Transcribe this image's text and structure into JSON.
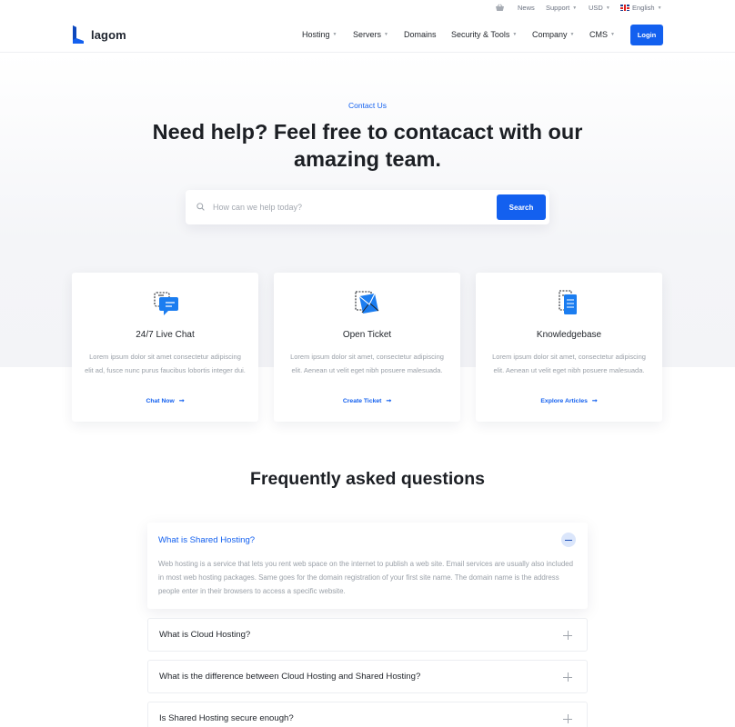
{
  "topbar": {
    "cart_icon": "basket-icon",
    "news": "News",
    "support": "Support",
    "currency": "USD",
    "language": "English",
    "flag_icon": "uk-flag-icon"
  },
  "header": {
    "brand": "lagom",
    "nav": [
      {
        "label": "Hosting",
        "dropdown": true
      },
      {
        "label": "Servers",
        "dropdown": true
      },
      {
        "label": "Domains",
        "dropdown": false
      },
      {
        "label": "Security & Tools",
        "dropdown": true
      },
      {
        "label": "Company",
        "dropdown": true
      },
      {
        "label": "CMS",
        "dropdown": true
      }
    ],
    "login_label": "Login"
  },
  "hero": {
    "eyebrow": "Contact Us",
    "title": "Need help? Feel free to contacact with our amazing team.",
    "search_placeholder": "How can we help today?",
    "search_button": "Search"
  },
  "cards": [
    {
      "icon": "live-chat-icon",
      "title": "24/7 Live Chat",
      "text": "Lorem ipsum dolor sit amet consectetur adipiscing elit ad, fusce nunc purus faucibus lobortis integer dui.",
      "link": "Chat Now"
    },
    {
      "icon": "ticket-envelope-icon",
      "title": "Open Ticket",
      "text": "Lorem ipsum dolor sit amet, consectetur adipiscing elit. Aenean ut velit eget nibh posuere malesuada.",
      "link": "Create Ticket"
    },
    {
      "icon": "knowledgebase-icon",
      "title": "Knowledgebase",
      "text": "Lorem ipsum dolor sit amet, consectetur adipiscing elit. Aenean ut velit eget nibh posuere malesuada.",
      "link": "Explore Articles"
    }
  ],
  "faq": {
    "title": "Frequently asked questions",
    "items": [
      {
        "question": "What is Shared Hosting?",
        "answer": "Web hosting is a service that lets you rent web space on the internet to publish a web site. Email services are usually also included in most web hosting packages. Same goes for the domain registration of your first site name. The domain name is the address people enter in their browsers to access a specific website.",
        "expanded": true
      },
      {
        "question": "What is Cloud Hosting?",
        "expanded": false
      },
      {
        "question": "What is the difference between Cloud Hosting and Shared Hosting?",
        "expanded": false
      },
      {
        "question": "Is Shared Hosting secure enough?",
        "expanded": false
      }
    ]
  },
  "colors": {
    "accent": "#1360ef",
    "heading": "#1c1f24",
    "muted": "#9aa0a8"
  }
}
